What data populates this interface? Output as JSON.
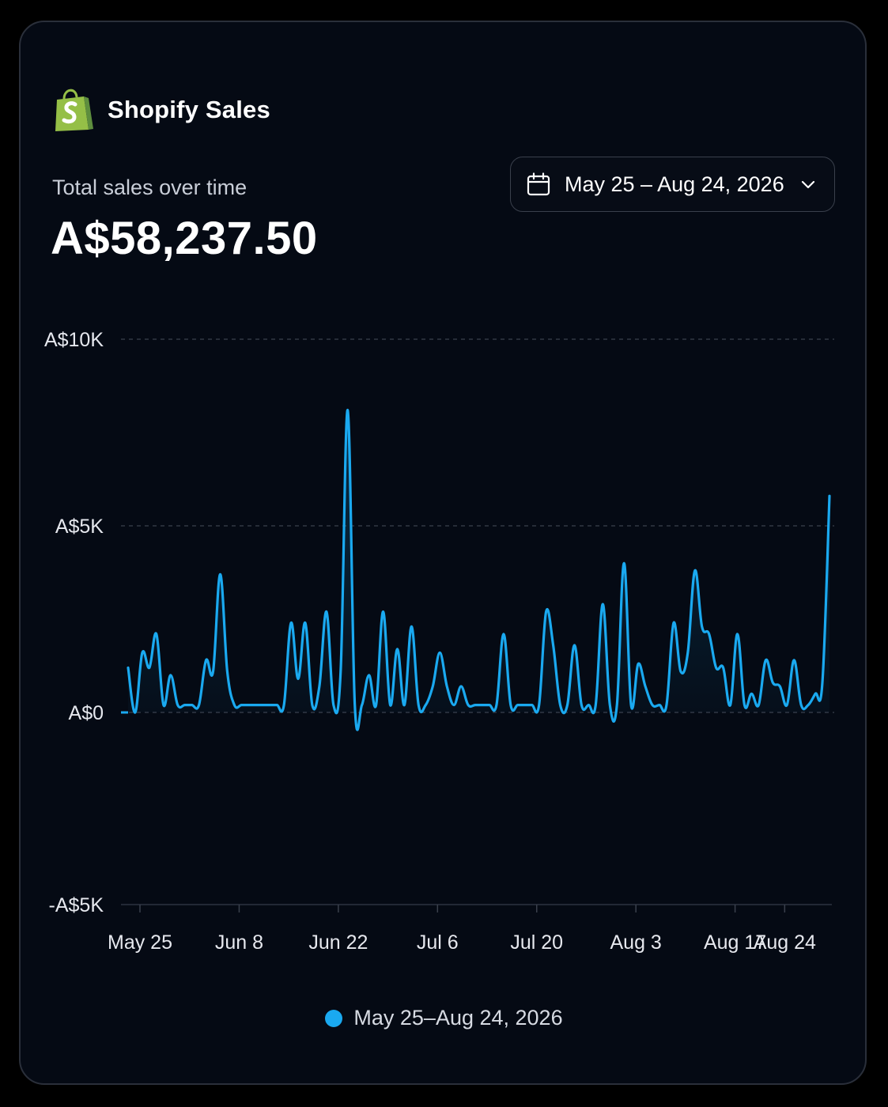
{
  "header": {
    "title": "Shopify Sales",
    "logo_icon": "shopify-bag-icon",
    "logo_color": "#95bf47"
  },
  "metric": {
    "label": "Total sales over time",
    "value": "A$58,237.50"
  },
  "date_picker": {
    "label": "May 25 – Aug 24, 2026",
    "icon": "calendar-icon",
    "dropdown_icon": "chevron-down-icon"
  },
  "colors": {
    "line": "#1aa9f0",
    "background": "#050a14",
    "grid": "#3a404c"
  },
  "chart_data": {
    "type": "area",
    "title": "",
    "xlabel": "",
    "ylabel": "",
    "ylim": [
      -5000,
      10000
    ],
    "y_ticks": [
      {
        "value": 10000,
        "label": "A$10K"
      },
      {
        "value": 5000,
        "label": "A$5K"
      },
      {
        "value": 0,
        "label": "A$0"
      },
      {
        "value": -5000,
        "label": "-A$5K"
      }
    ],
    "x_ticks": [
      {
        "day": 1,
        "label": "May 25"
      },
      {
        "day": 15,
        "label": "Jun 8"
      },
      {
        "day": 29,
        "label": "Jun 22"
      },
      {
        "day": 43,
        "label": "Jul 6"
      },
      {
        "day": 57,
        "label": "Jul 20"
      },
      {
        "day": 71,
        "label": "Aug 3"
      },
      {
        "day": 85,
        "label": "Aug 17"
      },
      {
        "day": 92,
        "label": "Aug 24"
      }
    ],
    "grid": true,
    "legend_position": "bottom",
    "series": [
      {
        "name": "May 25–Aug 24, 2026",
        "values": [
          1200,
          0,
          1600,
          1200,
          2100,
          200,
          1000,
          200,
          200,
          200,
          200,
          1400,
          1100,
          3700,
          1100,
          200,
          200,
          200,
          200,
          200,
          200,
          200,
          200,
          2400,
          900,
          2400,
          200,
          700,
          2700,
          200,
          1100,
          8100,
          200,
          200,
          1000,
          200,
          2700,
          200,
          1700,
          200,
          2300,
          200,
          200,
          700,
          1600,
          700,
          200,
          700,
          200,
          200,
          200,
          200,
          200,
          2100,
          200,
          200,
          200,
          200,
          200,
          2700,
          1800,
          200,
          200,
          1800,
          200,
          200,
          200,
          2900,
          200,
          200,
          4000,
          200,
          1300,
          700,
          200,
          200,
          200,
          2400,
          1100,
          1600,
          3800,
          2300,
          2100,
          1200,
          1200,
          200,
          2100,
          200,
          500,
          200,
          1400,
          800,
          700,
          200,
          1400,
          200,
          200,
          500,
          800,
          5800
        ]
      }
    ]
  },
  "legend": {
    "label": "May 25–Aug 24, 2026"
  }
}
